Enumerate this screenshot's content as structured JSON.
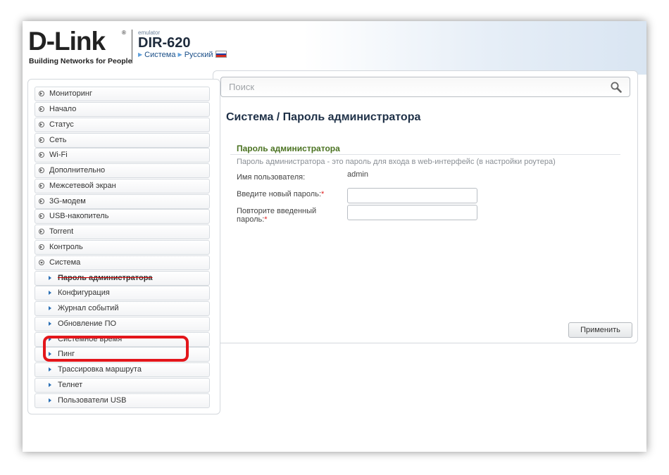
{
  "header": {
    "logo_text": "D-Link",
    "logo_reg": "®",
    "logo_tagline": "Building Networks for People",
    "emulator_label": "emulator",
    "model": "DIR-620",
    "crumbs": [
      "Система",
      "Русский"
    ],
    "flag_colors": [
      "#ffffff",
      "#1c3fa6",
      "#d52b1e"
    ]
  },
  "sidebar": {
    "items": [
      {
        "label": "Мониторинг"
      },
      {
        "label": "Начало"
      },
      {
        "label": "Статус"
      },
      {
        "label": "Сеть"
      },
      {
        "label": "Wi-Fi"
      },
      {
        "label": "Дополнительно"
      },
      {
        "label": "Межсетевой экран"
      },
      {
        "label": "3G-модем"
      },
      {
        "label": "USB-накопитель"
      },
      {
        "label": "Torrent"
      },
      {
        "label": "Контроль"
      },
      {
        "label": "Система"
      }
    ],
    "subitems": [
      {
        "label": "Пароль администратора"
      },
      {
        "label": "Конфигурация"
      },
      {
        "label": "Журнал событий"
      },
      {
        "label": "Обновление ПО"
      },
      {
        "label": "Системное время"
      },
      {
        "label": "Пинг"
      },
      {
        "label": "Трассировка маршрута"
      },
      {
        "label": "Телнет"
      },
      {
        "label": "Пользователи USB"
      }
    ],
    "highlight_color": "#e3161b"
  },
  "search": {
    "placeholder": "Поиск",
    "icon": "magnifier-icon"
  },
  "main": {
    "title": "Система /  Пароль администратора",
    "section_title": "Пароль администратора",
    "section_desc": "Пароль администратора - это пароль для входа в web-интерфейс (в настройки роутера)",
    "username_label": "Имя пользователя:",
    "username_value": "admin",
    "new_password_label": "Введите новый пароль:",
    "repeat_password_label_1": "Повторите введенный",
    "repeat_password_label_2": "пароль:",
    "required_mark": "*",
    "apply_label": "Применить"
  },
  "colors": {
    "section_green": "#4b7322",
    "title_navy": "#1e3047",
    "link_blue": "#1b4f88"
  }
}
